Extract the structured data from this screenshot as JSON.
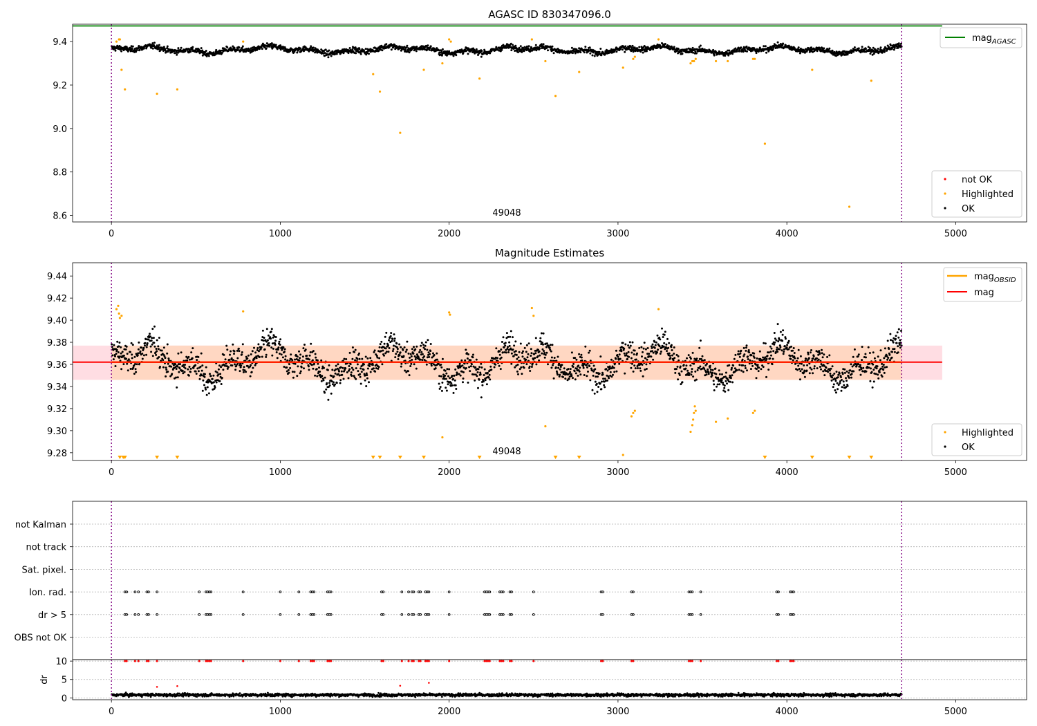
{
  "chart_data": [
    {
      "type": "scatter",
      "title": "AGASC ID 830347096.0",
      "xlim": [
        -230,
        5420
      ],
      "ylim": [
        8.57,
        9.48
      ],
      "x_ticks": [
        0,
        1000,
        2000,
        3000,
        4000,
        5000
      ],
      "y_ticks": [
        8.6,
        8.8,
        9.0,
        9.2,
        9.4
      ],
      "y_tick_labels": [
        "8.6",
        "8.8",
        "9.0",
        "9.2",
        "9.4"
      ],
      "annotation": "49048",
      "obs_boundaries": [
        0,
        4680
      ],
      "mag_agasc": 9.472,
      "mag_agasc_extent": [
        -230,
        4920
      ],
      "ok_band": {
        "x": [
          0,
          4680
        ],
        "center": 9.362,
        "amplitude": 0.03
      },
      "series": [
        {
          "name": "not OK",
          "color": "#ff0000",
          "points": []
        },
        {
          "name": "Highlighted",
          "color": "#ffa500",
          "points": [
            [
              30,
              9.4
            ],
            [
              45,
              9.41
            ],
            [
              50,
              9.41
            ],
            [
              60,
              9.27
            ],
            [
              80,
              9.18
            ],
            [
              270,
              9.16
            ],
            [
              390,
              9.18
            ],
            [
              780,
              9.4
            ],
            [
              1550,
              9.25
            ],
            [
              1590,
              9.17
            ],
            [
              1710,
              8.98
            ],
            [
              1850,
              9.27
            ],
            [
              1960,
              9.3
            ],
            [
              2000,
              9.41
            ],
            [
              2010,
              9.4
            ],
            [
              2180,
              9.23
            ],
            [
              2490,
              9.41
            ],
            [
              2570,
              9.31
            ],
            [
              2630,
              9.15
            ],
            [
              2770,
              9.26
            ],
            [
              3030,
              9.28
            ],
            [
              3090,
              9.32
            ],
            [
              3100,
              9.33
            ],
            [
              3240,
              9.41
            ],
            [
              3430,
              9.3
            ],
            [
              3440,
              9.31
            ],
            [
              3450,
              9.31
            ],
            [
              3460,
              9.32
            ],
            [
              3580,
              9.31
            ],
            [
              3650,
              9.31
            ],
            [
              3800,
              9.32
            ],
            [
              3810,
              9.32
            ],
            [
              3870,
              8.93
            ],
            [
              4150,
              9.27
            ],
            [
              4370,
              8.64
            ],
            [
              4500,
              9.22
            ]
          ]
        },
        {
          "name": "OK",
          "color": "#000000",
          "points": []
        }
      ],
      "legends": {
        "upper": [
          "mag_AGASC"
        ],
        "lower": [
          "not OK",
          "Highlighted",
          "OK"
        ]
      }
    },
    {
      "type": "scatter",
      "title": "Magnitude Estimates",
      "xlim": [
        -230,
        5420
      ],
      "ylim": [
        9.273,
        9.452
      ],
      "x_ticks": [
        0,
        1000,
        2000,
        3000,
        4000,
        5000
      ],
      "y_ticks": [
        9.28,
        9.3,
        9.32,
        9.34,
        9.36,
        9.38,
        9.4,
        9.42,
        9.44
      ],
      "y_tick_labels": [
        "9.28",
        "9.30",
        "9.32",
        "9.34",
        "9.36",
        "9.38",
        "9.40",
        "9.42",
        "9.44"
      ],
      "annotation": "49048",
      "obs_boundaries": [
        0,
        4680
      ],
      "mag": 9.362,
      "mag_extent": [
        -230,
        4920
      ],
      "mag_band": [
        9.346,
        9.377
      ],
      "mag_obsid": 9.362,
      "mag_obsid_extent": [
        0,
        4680
      ],
      "series": [
        {
          "name": "Highlighted",
          "color": "#ffa500",
          "points": [
            [
              30,
              9.41
            ],
            [
              40,
              9.413
            ],
            [
              45,
              9.406
            ],
            [
              50,
              9.402
            ],
            [
              60,
              9.404
            ],
            [
              780,
              9.408
            ],
            [
              1960,
              9.294
            ],
            [
              2000,
              9.407
            ],
            [
              2005,
              9.405
            ],
            [
              2490,
              9.411
            ],
            [
              2500,
              9.404
            ],
            [
              2570,
              9.304
            ],
            [
              3030,
              9.278
            ],
            [
              3080,
              9.313
            ],
            [
              3090,
              9.316
            ],
            [
              3100,
              9.318
            ],
            [
              3240,
              9.41
            ],
            [
              3430,
              9.299
            ],
            [
              3440,
              9.305
            ],
            [
              3445,
              9.31
            ],
            [
              3450,
              9.316
            ],
            [
              3455,
              9.322
            ],
            [
              3460,
              9.318
            ],
            [
              3580,
              9.308
            ],
            [
              3650,
              9.311
            ],
            [
              3800,
              9.316
            ],
            [
              3810,
              9.318
            ]
          ]
        },
        {
          "name": "OK",
          "color": "#000000",
          "points": []
        }
      ],
      "offscale_markers_x": [
        50,
        70,
        80,
        270,
        390,
        1550,
        1590,
        1710,
        1850,
        2180,
        2630,
        2770,
        3870,
        4150,
        4370,
        4500
      ],
      "legends": {
        "upper": [
          "mag_OBSID",
          "mag"
        ],
        "lower": [
          "Highlighted",
          "OK"
        ]
      }
    },
    {
      "type": "scatter",
      "title": "",
      "xlim": [
        -230,
        5420
      ],
      "x_ticks": [
        0,
        1000,
        2000,
        3000,
        4000,
        5000
      ],
      "obs_boundaries": [
        0,
        4680
      ],
      "flag_categories": [
        "not Kalman",
        "not track",
        "Sat. pixel.",
        "Ion. rad.",
        "dr > 5",
        "OBS not OK"
      ],
      "flag_times": [
        80,
        90,
        140,
        160,
        210,
        220,
        270,
        520,
        560,
        570,
        580,
        590,
        780,
        1000,
        1110,
        1180,
        1190,
        1200,
        1280,
        1290,
        1300,
        1600,
        1610,
        1720,
        1760,
        1780,
        1790,
        1820,
        1830,
        1860,
        1870,
        1880,
        2000,
        2210,
        2220,
        2230,
        2240,
        2300,
        2310,
        2320,
        2360,
        2370,
        2500,
        2900,
        2910,
        3080,
        3090,
        3420,
        3430,
        3440,
        3490,
        3940,
        3950,
        4020,
        4030,
        4040
      ],
      "flagged_categories": [
        "Ion. rad.",
        "dr > 5"
      ],
      "dr_panel": {
        "ylabel": "dr",
        "ylim": [
          -0.5,
          10.4
        ],
        "y_ticks": [
          0,
          5,
          10
        ],
        "y_tick_labels": [
          "0",
          "5",
          "10"
        ],
        "red_points": [
          [
            270,
            3.0
          ],
          [
            390,
            3.2
          ],
          [
            1710,
            3.3
          ],
          [
            1880,
            4.1
          ]
        ],
        "clip_value": 10
      },
      "series": [
        {
          "name": "dr",
          "color": "#000000",
          "points": []
        }
      ]
    }
  ],
  "legend_text": {
    "mag_agasc": "mag",
    "mag_agasc_sub": "AGASC",
    "mag_obsid": "mag",
    "mag_obsid_sub": "OBSID",
    "mag": "mag",
    "not_ok": "not OK",
    "highlighted": "Highlighted",
    "ok": "OK"
  },
  "colors": {
    "ok": "#000000",
    "highlighted": "#ffa500",
    "not_ok": "#ff0000",
    "agasc": "#008000",
    "mag": "#ff0000",
    "band": "#ffdde3",
    "band_orange": "#ffd7c2",
    "boundary": "#800080"
  }
}
